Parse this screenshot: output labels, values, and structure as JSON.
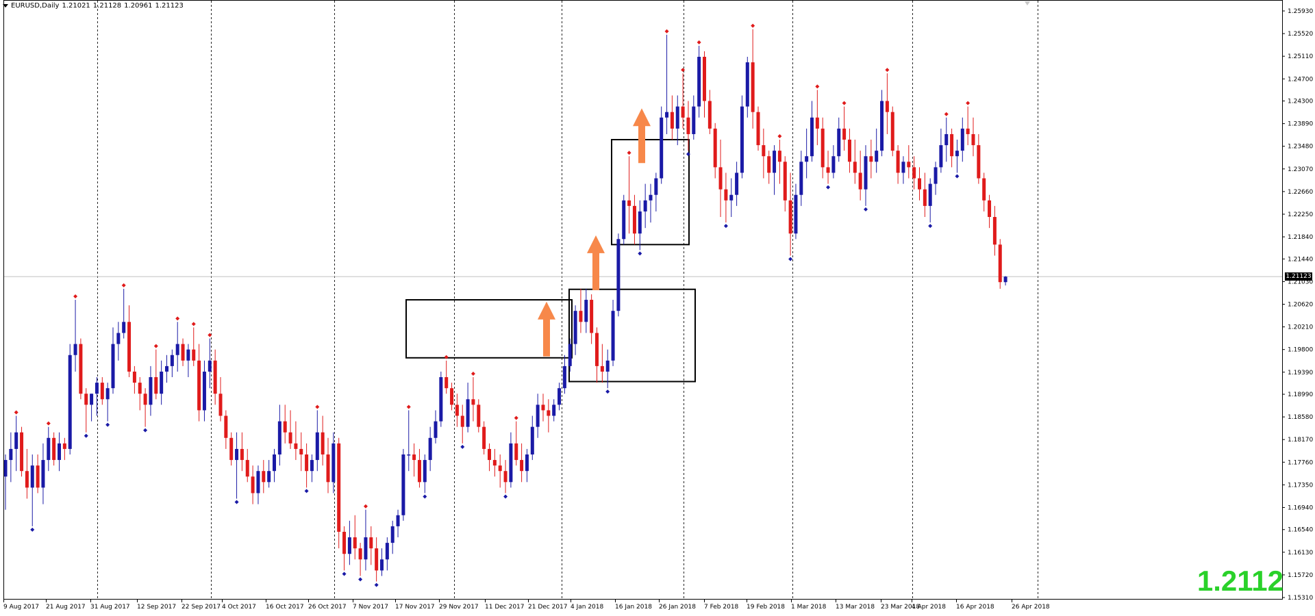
{
  "header": {
    "symbol": "EURUSD,Daily",
    "open": "1.21021",
    "high": "1.21128",
    "low": "1.20961",
    "close": "1.21123"
  },
  "current_price_tag": "1.21123",
  "big_price_label": "1.2112",
  "colors": {
    "bull": "#1a1aa6",
    "bear": "#e01b1b",
    "arrow": "#f7884a",
    "bigPrice": "#2ad12a"
  },
  "chart_data": {
    "type": "candlestick",
    "title": "",
    "ylim": [
      1.151,
      1.263
    ],
    "price_ticks": [
      "1.25930",
      "1.25520",
      "1.25110",
      "1.24700",
      "1.24300",
      "1.23890",
      "1.23480",
      "1.23070",
      "1.22660",
      "1.22250",
      "1.21840",
      "1.21440",
      "1.21030",
      "1.20620",
      "1.20210",
      "1.19800",
      "1.19390",
      "1.18990",
      "1.18580",
      "1.18170",
      "1.17760",
      "1.17350",
      "1.16940",
      "1.16540",
      "1.16130",
      "1.15720",
      "1.15310"
    ],
    "date_labels": [
      "9 Aug 2017",
      "21 Aug 2017",
      "31 Aug 2017",
      "12 Sep 2017",
      "22 Sep 2017",
      "4 Oct 2017",
      "16 Oct 2017",
      "26 Oct 2017",
      "7 Nov 2017",
      "17 Nov 2017",
      "29 Nov 2017",
      "11 Dec 2017",
      "21 Dec 2017",
      "4 Jan 2018",
      "16 Jan 2018",
      "26 Jan 2018",
      "7 Feb 2018",
      "19 Feb 2018",
      "1 Mar 2018",
      "13 Mar 2018",
      "23 Mar 2018",
      "4 Apr 2018",
      "16 Apr 2018",
      "26 Apr 2018"
    ],
    "ohlc": [
      [
        1.175,
        1.179,
        1.169,
        1.178
      ],
      [
        1.178,
        1.183,
        1.174,
        1.18
      ],
      [
        1.18,
        1.186,
        1.176,
        1.183
      ],
      [
        1.183,
        1.184,
        1.175,
        1.176
      ],
      [
        1.176,
        1.18,
        1.171,
        1.173
      ],
      [
        1.173,
        1.179,
        1.166,
        1.177
      ],
      [
        1.177,
        1.179,
        1.172,
        1.173
      ],
      [
        1.173,
        1.181,
        1.17,
        1.178
      ],
      [
        1.178,
        1.184,
        1.176,
        1.182
      ],
      [
        1.182,
        1.183,
        1.177,
        1.178
      ],
      [
        1.178,
        1.183,
        1.176,
        1.181
      ],
      [
        1.181,
        1.182,
        1.178,
        1.18
      ],
      [
        1.18,
        1.199,
        1.179,
        1.197
      ],
      [
        1.197,
        1.207,
        1.194,
        1.199
      ],
      [
        1.199,
        1.2,
        1.189,
        1.19
      ],
      [
        1.19,
        1.191,
        1.183,
        1.188
      ],
      [
        1.188,
        1.19,
        1.185,
        1.19
      ],
      [
        1.19,
        1.193,
        1.186,
        1.192
      ],
      [
        1.192,
        1.193,
        1.188,
        1.189
      ],
      [
        1.189,
        1.192,
        1.185,
        1.191
      ],
      [
        1.191,
        1.202,
        1.19,
        1.199
      ],
      [
        1.199,
        1.203,
        1.196,
        1.201
      ],
      [
        1.201,
        1.209,
        1.2,
        1.203
      ],
      [
        1.203,
        1.206,
        1.193,
        1.194
      ],
      [
        1.194,
        1.195,
        1.19,
        1.192
      ],
      [
        1.192,
        1.193,
        1.187,
        1.19
      ],
      [
        1.19,
        1.191,
        1.184,
        1.188
      ],
      [
        1.188,
        1.195,
        1.186,
        1.193
      ],
      [
        1.193,
        1.198,
        1.189,
        1.19
      ],
      [
        1.19,
        1.196,
        1.188,
        1.194
      ],
      [
        1.194,
        1.197,
        1.192,
        1.195
      ],
      [
        1.195,
        1.198,
        1.193,
        1.197
      ],
      [
        1.197,
        1.203,
        1.194,
        1.199
      ],
      [
        1.199,
        1.2,
        1.195,
        1.196
      ],
      [
        1.196,
        1.199,
        1.193,
        1.198
      ],
      [
        1.198,
        1.202,
        1.195,
        1.196
      ],
      [
        1.196,
        1.199,
        1.185,
        1.187
      ],
      [
        1.187,
        1.196,
        1.185,
        1.194
      ],
      [
        1.194,
        1.2,
        1.191,
        1.196
      ],
      [
        1.196,
        1.198,
        1.188,
        1.19
      ],
      [
        1.19,
        1.193,
        1.185,
        1.186
      ],
      [
        1.186,
        1.187,
        1.18,
        1.182
      ],
      [
        1.182,
        1.183,
        1.177,
        1.178
      ],
      [
        1.178,
        1.183,
        1.171,
        1.18
      ],
      [
        1.18,
        1.183,
        1.176,
        1.178
      ],
      [
        1.178,
        1.18,
        1.174,
        1.175
      ],
      [
        1.175,
        1.177,
        1.17,
        1.172
      ],
      [
        1.172,
        1.177,
        1.17,
        1.176
      ],
      [
        1.176,
        1.178,
        1.172,
        1.174
      ],
      [
        1.174,
        1.178,
        1.173,
        1.176
      ],
      [
        1.176,
        1.18,
        1.174,
        1.179
      ],
      [
        1.179,
        1.188,
        1.177,
        1.185
      ],
      [
        1.185,
        1.188,
        1.181,
        1.183
      ],
      [
        1.183,
        1.187,
        1.18,
        1.181
      ],
      [
        1.181,
        1.185,
        1.178,
        1.18
      ],
      [
        1.18,
        1.183,
        1.176,
        1.179
      ],
      [
        1.179,
        1.181,
        1.173,
        1.176
      ],
      [
        1.176,
        1.179,
        1.174,
        1.178
      ],
      [
        1.178,
        1.187,
        1.176,
        1.183
      ],
      [
        1.183,
        1.186,
        1.177,
        1.179
      ],
      [
        1.179,
        1.182,
        1.172,
        1.174
      ],
      [
        1.174,
        1.183,
        1.172,
        1.181
      ],
      [
        1.181,
        1.182,
        1.162,
        1.165
      ],
      [
        1.165,
        1.166,
        1.158,
        1.161
      ],
      [
        1.161,
        1.167,
        1.159,
        1.164
      ],
      [
        1.164,
        1.168,
        1.16,
        1.162
      ],
      [
        1.162,
        1.163,
        1.157,
        1.16
      ],
      [
        1.16,
        1.169,
        1.158,
        1.164
      ],
      [
        1.164,
        1.166,
        1.159,
        1.162
      ],
      [
        1.162,
        1.164,
        1.156,
        1.158
      ],
      [
        1.158,
        1.162,
        1.157,
        1.16
      ],
      [
        1.16,
        1.164,
        1.158,
        1.163
      ],
      [
        1.163,
        1.167,
        1.161,
        1.166
      ],
      [
        1.166,
        1.169,
        1.164,
        1.168
      ],
      [
        1.168,
        1.18,
        1.167,
        1.179
      ],
      [
        1.179,
        1.187,
        1.176,
        1.179
      ],
      [
        1.179,
        1.181,
        1.175,
        1.178
      ],
      [
        1.178,
        1.18,
        1.173,
        1.174
      ],
      [
        1.174,
        1.179,
        1.172,
        1.178
      ],
      [
        1.178,
        1.184,
        1.176,
        1.182
      ],
      [
        1.182,
        1.187,
        1.181,
        1.185
      ],
      [
        1.185,
        1.194,
        1.184,
        1.193
      ],
      [
        1.193,
        1.196,
        1.19,
        1.191
      ],
      [
        1.191,
        1.192,
        1.187,
        1.188
      ],
      [
        1.188,
        1.19,
        1.184,
        1.186
      ],
      [
        1.186,
        1.188,
        1.181,
        1.184
      ],
      [
        1.184,
        1.192,
        1.183,
        1.189
      ],
      [
        1.189,
        1.193,
        1.185,
        1.188
      ],
      [
        1.188,
        1.189,
        1.183,
        1.184
      ],
      [
        1.184,
        1.185,
        1.179,
        1.18
      ],
      [
        1.18,
        1.181,
        1.176,
        1.178
      ],
      [
        1.178,
        1.18,
        1.175,
        1.177
      ],
      [
        1.177,
        1.179,
        1.173,
        1.176
      ],
      [
        1.176,
        1.178,
        1.172,
        1.174
      ],
      [
        1.174,
        1.183,
        1.173,
        1.181
      ],
      [
        1.181,
        1.185,
        1.177,
        1.178
      ],
      [
        1.178,
        1.181,
        1.174,
        1.176
      ],
      [
        1.176,
        1.18,
        1.174,
        1.179
      ],
      [
        1.179,
        1.186,
        1.178,
        1.184
      ],
      [
        1.184,
        1.19,
        1.182,
        1.188
      ],
      [
        1.188,
        1.19,
        1.185,
        1.187
      ],
      [
        1.187,
        1.189,
        1.183,
        1.186
      ],
      [
        1.186,
        1.189,
        1.185,
        1.188
      ],
      [
        1.188,
        1.192,
        1.187,
        1.191
      ],
      [
        1.191,
        1.197,
        1.19,
        1.195
      ],
      [
        1.195,
        1.2,
        1.194,
        1.199
      ],
      [
        1.199,
        1.206,
        1.197,
        1.205
      ],
      [
        1.205,
        1.209,
        1.201,
        1.203
      ],
      [
        1.203,
        1.209,
        1.201,
        1.207
      ],
      [
        1.207,
        1.208,
        1.199,
        1.201
      ],
      [
        1.201,
        1.202,
        1.192,
        1.195
      ],
      [
        1.195,
        1.199,
        1.192,
        1.194
      ],
      [
        1.194,
        1.198,
        1.191,
        1.196
      ],
      [
        1.196,
        1.207,
        1.195,
        1.205
      ],
      [
        1.205,
        1.219,
        1.204,
        1.218
      ],
      [
        1.218,
        1.226,
        1.217,
        1.225
      ],
      [
        1.225,
        1.233,
        1.219,
        1.224
      ],
      [
        1.224,
        1.226,
        1.217,
        1.219
      ],
      [
        1.219,
        1.225,
        1.216,
        1.223
      ],
      [
        1.223,
        1.228,
        1.22,
        1.225
      ],
      [
        1.225,
        1.228,
        1.221,
        1.226
      ],
      [
        1.226,
        1.23,
        1.223,
        1.229
      ],
      [
        1.229,
        1.242,
        1.228,
        1.24
      ],
      [
        1.24,
        1.255,
        1.237,
        1.241
      ],
      [
        1.241,
        1.244,
        1.236,
        1.238
      ],
      [
        1.238,
        1.244,
        1.235,
        1.242
      ],
      [
        1.242,
        1.248,
        1.238,
        1.24
      ],
      [
        1.24,
        1.243,
        1.234,
        1.237
      ],
      [
        1.237,
        1.244,
        1.236,
        1.242
      ],
      [
        1.242,
        1.253,
        1.24,
        1.251
      ],
      [
        1.251,
        1.252,
        1.24,
        1.243
      ],
      [
        1.243,
        1.245,
        1.237,
        1.238
      ],
      [
        1.238,
        1.239,
        1.229,
        1.231
      ],
      [
        1.231,
        1.236,
        1.222,
        1.227
      ],
      [
        1.227,
        1.23,
        1.221,
        1.225
      ],
      [
        1.225,
        1.229,
        1.222,
        1.226
      ],
      [
        1.226,
        1.232,
        1.224,
        1.23
      ],
      [
        1.23,
        1.244,
        1.229,
        1.242
      ],
      [
        1.242,
        1.251,
        1.24,
        1.25
      ],
      [
        1.25,
        1.256,
        1.238,
        1.241
      ],
      [
        1.241,
        1.242,
        1.234,
        1.235
      ],
      [
        1.235,
        1.238,
        1.229,
        1.233
      ],
      [
        1.233,
        1.234,
        1.228,
        1.23
      ],
      [
        1.23,
        1.235,
        1.226,
        1.234
      ],
      [
        1.234,
        1.236,
        1.228,
        1.232
      ],
      [
        1.232,
        1.233,
        1.223,
        1.225
      ],
      [
        1.225,
        1.23,
        1.215,
        1.219
      ],
      [
        1.219,
        1.228,
        1.218,
        1.226
      ],
      [
        1.226,
        1.234,
        1.224,
        1.232
      ],
      [
        1.232,
        1.238,
        1.229,
        1.233
      ],
      [
        1.233,
        1.243,
        1.232,
        1.24
      ],
      [
        1.24,
        1.245,
        1.235,
        1.238
      ],
      [
        1.238,
        1.24,
        1.229,
        1.231
      ],
      [
        1.231,
        1.234,
        1.228,
        1.23
      ],
      [
        1.23,
        1.235,
        1.229,
        1.233
      ],
      [
        1.233,
        1.24,
        1.232,
        1.238
      ],
      [
        1.238,
        1.242,
        1.234,
        1.236
      ],
      [
        1.236,
        1.238,
        1.23,
        1.232
      ],
      [
        1.232,
        1.236,
        1.228,
        1.23
      ],
      [
        1.23,
        1.234,
        1.225,
        1.227
      ],
      [
        1.227,
        1.235,
        1.224,
        1.233
      ],
      [
        1.233,
        1.236,
        1.229,
        1.232
      ],
      [
        1.232,
        1.238,
        1.23,
        1.234
      ],
      [
        1.234,
        1.245,
        1.233,
        1.243
      ],
      [
        1.243,
        1.248,
        1.237,
        1.241
      ],
      [
        1.241,
        1.242,
        1.233,
        1.234
      ],
      [
        1.234,
        1.235,
        1.228,
        1.23
      ],
      [
        1.23,
        1.233,
        1.228,
        1.232
      ],
      [
        1.232,
        1.235,
        1.229,
        1.231
      ],
      [
        1.231,
        1.233,
        1.227,
        1.229
      ],
      [
        1.229,
        1.231,
        1.225,
        1.227
      ],
      [
        1.227,
        1.23,
        1.222,
        1.224
      ],
      [
        1.224,
        1.229,
        1.221,
        1.228
      ],
      [
        1.228,
        1.232,
        1.226,
        1.231
      ],
      [
        1.231,
        1.238,
        1.23,
        1.235
      ],
      [
        1.235,
        1.24,
        1.232,
        1.237
      ],
      [
        1.237,
        1.238,
        1.231,
        1.233
      ],
      [
        1.233,
        1.236,
        1.23,
        1.234
      ],
      [
        1.234,
        1.24,
        1.232,
        1.238
      ],
      [
        1.238,
        1.242,
        1.235,
        1.237
      ],
      [
        1.237,
        1.24,
        1.233,
        1.235
      ],
      [
        1.235,
        1.237,
        1.228,
        1.229
      ],
      [
        1.229,
        1.23,
        1.223,
        1.225
      ],
      [
        1.225,
        1.226,
        1.22,
        1.222
      ],
      [
        1.222,
        1.224,
        1.215,
        1.217
      ],
      [
        1.217,
        1.218,
        1.209,
        1.2102
      ],
      [
        1.2102,
        1.2113,
        1.2096,
        1.2112
      ]
    ],
    "boxes": [
      {
        "from": 1.207,
        "to": 1.1965,
        "start": 8,
        "end": 10
      },
      {
        "from": 1.2089,
        "to": 1.1922,
        "start": 12,
        "end": 13
      },
      {
        "from": 1.236,
        "to": 1.217,
        "start": 14,
        "end": 15
      }
    ],
    "arrows": [
      {
        "price": 1.197
      },
      {
        "price": 1.209
      },
      {
        "price": 1.232
      }
    ]
  }
}
